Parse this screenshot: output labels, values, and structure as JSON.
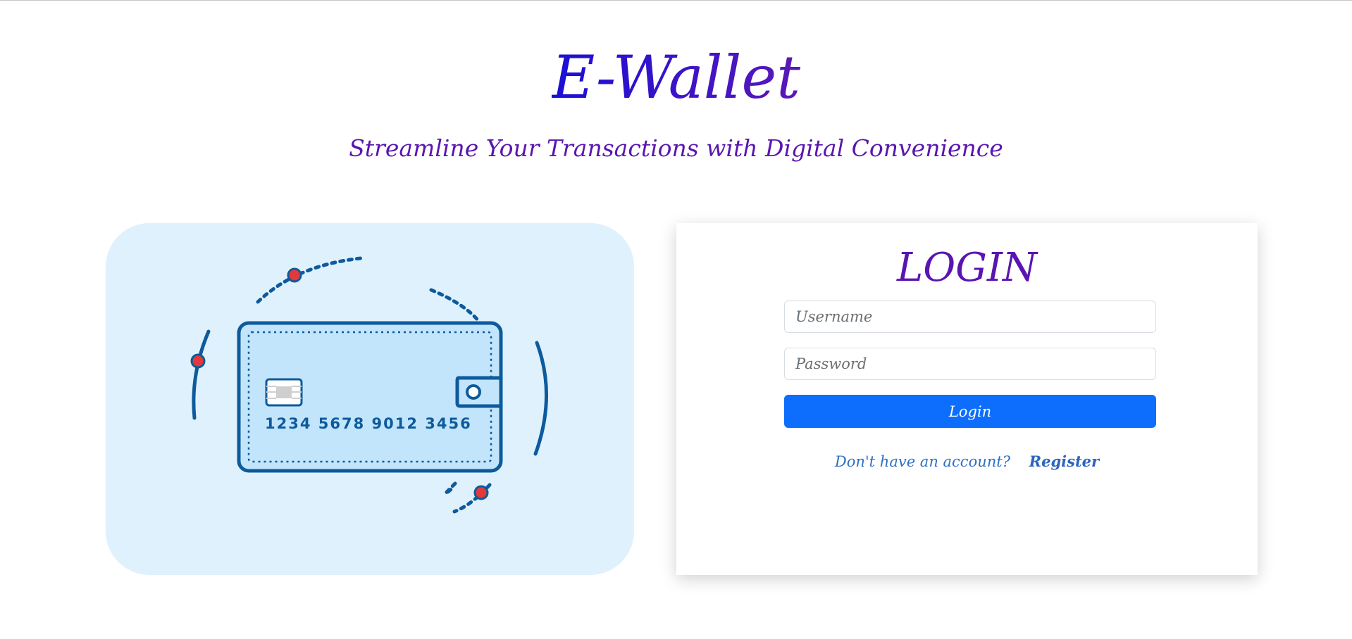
{
  "header": {
    "title": "E-Wallet",
    "tagline": "Streamline Your Transactions with Digital Convenience"
  },
  "illustration": {
    "card_number": "1234 5678 9012 3456"
  },
  "login": {
    "heading": "LOGIN",
    "username_placeholder": "Username",
    "password_placeholder": "Password",
    "button_label": "Login",
    "register_prompt": "Don't have an account?",
    "register_link": "Register"
  },
  "colors": {
    "title_gradient_start": "#1a0fd6",
    "title_gradient_end": "#5a18b8",
    "purple": "#5a14b2",
    "panel_bg": "#dff1fd",
    "primary_button": "#0d6efd",
    "link": "#2b64c0"
  }
}
